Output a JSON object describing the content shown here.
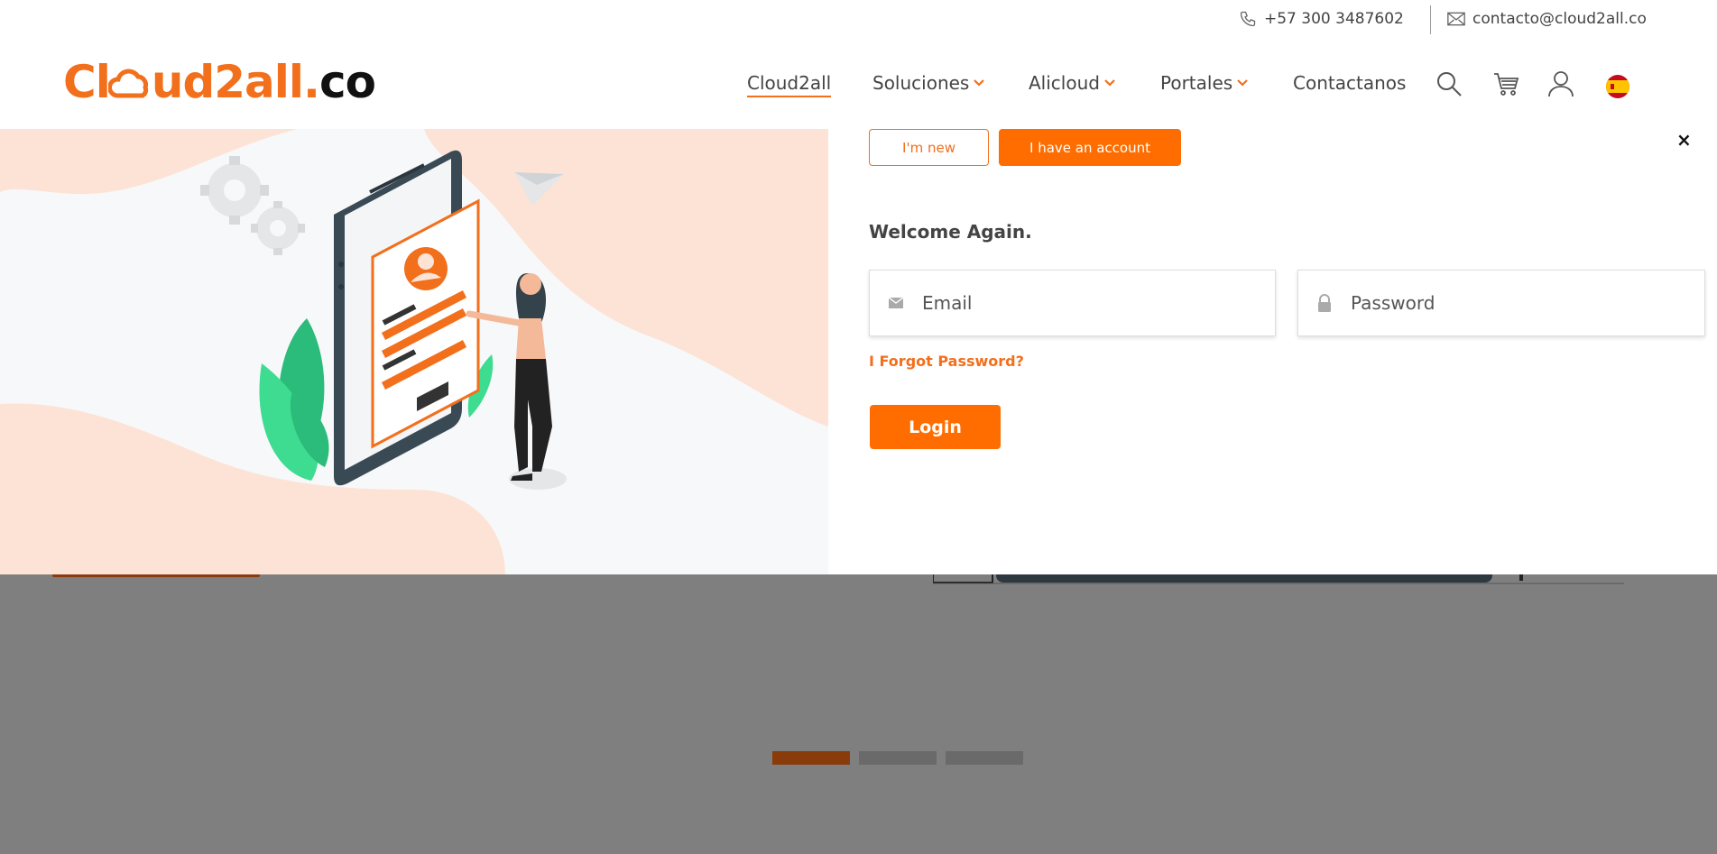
{
  "topbar": {
    "phone": "+57 300 3487602",
    "email": "contacto@cloud2all.co"
  },
  "logo": {
    "part1": "Cl",
    "part2": "ud2all.",
    "part3": "co"
  },
  "nav": {
    "items": [
      {
        "label": "Cloud2all",
        "dropdown": false,
        "active": true
      },
      {
        "label": "Soluciones",
        "dropdown": true
      },
      {
        "label": "Alicloud",
        "dropdown": true
      },
      {
        "label": "Portales",
        "dropdown": true
      },
      {
        "label": "Contactanos",
        "dropdown": false
      }
    ],
    "icons": [
      "search-icon",
      "cart-icon",
      "user-icon",
      "spain-flag-icon"
    ]
  },
  "modal": {
    "tab_new": "I'm new",
    "tab_account": "I have an account",
    "close": "×",
    "welcome": "Welcome Again.",
    "email_placeholder": "Email",
    "password_placeholder": "Password",
    "forgot": "I Forgot Password?",
    "login": "Login"
  },
  "slider": {
    "slide_count": 3,
    "active_index": 0
  },
  "colors": {
    "brand_orange": "#ff6d00",
    "overlay_gray": "#7f7f7f"
  }
}
